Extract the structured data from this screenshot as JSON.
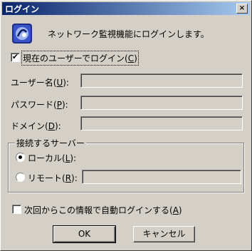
{
  "window": {
    "title": "ログイン",
    "close_glyph": "×"
  },
  "intro_text": "ネットワーク監視機能にログインします。",
  "use_current_user": {
    "label_prefix": "現在のユーザーでログイン(",
    "accel": "C",
    "label_suffix": ")",
    "checked": true
  },
  "fields": {
    "username": {
      "label_prefix": "ユーザー名(",
      "accel": "U",
      "label_suffix": "):",
      "value": ""
    },
    "password": {
      "label_prefix": "パスワード(",
      "accel": "P",
      "label_suffix": "):",
      "value": ""
    },
    "domain": {
      "label_prefix": "ドメイン(",
      "accel": "D",
      "label_suffix": "):",
      "value": ""
    }
  },
  "server_group": {
    "title": "接続するサーバー",
    "local": {
      "label_prefix": "ローカル(",
      "accel": "L",
      "label_suffix": "):",
      "selected": true
    },
    "remote": {
      "label_prefix": "リモート(",
      "accel": "R",
      "label_suffix": "):",
      "selected": false,
      "value": ""
    }
  },
  "auto_login": {
    "label_prefix": "次回からこの情報で自動ログインする(",
    "accel": "A",
    "label_suffix": ")",
    "checked": false
  },
  "buttons": {
    "ok": "OK",
    "cancel": "キャンセル"
  },
  "colors": {
    "face": "#d4d0c8",
    "titlebar": "#0a246a"
  },
  "icons": {
    "app": "network-monitor-icon",
    "check": "✔"
  }
}
